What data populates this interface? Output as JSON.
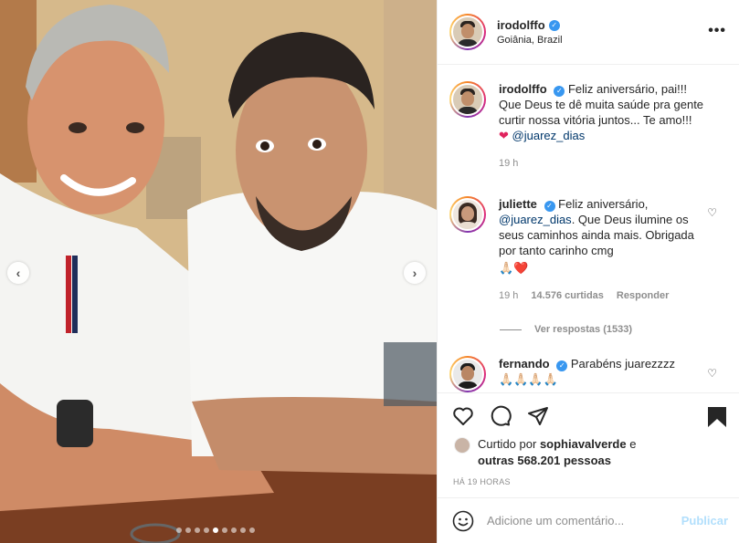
{
  "photo": {
    "dots_total": 9,
    "dots_active": 5
  },
  "header": {
    "username": "irodolffo",
    "location": "Goiânia, Brazil",
    "more_label": "•••"
  },
  "caption": {
    "username": "irodolffo",
    "text": "Feliz aniversário, pai!!! Que Deus te dê muita saúde pra gente curtir nossa vitória juntos... Te amo!!!",
    "mention": "@juarez_dias",
    "time": "19 h"
  },
  "comments": [
    {
      "username": "juliette",
      "text_before": "Feliz aniversário,",
      "mention": "@juarez_dias",
      "text_after": ". Que Deus ilumine os seus caminhos ainda mais. Obrigada por tanto carinho cmg",
      "emoji": "🙏🏻❤️",
      "time": "19 h",
      "likes": "14.576 curtidas",
      "reply": "Responder",
      "view_replies": "Ver respostas (1533)"
    },
    {
      "username": "fernando",
      "text": "Parabéns juarezzzz",
      "emoji": "🙏🏻🙏🏻🙏🏻🙏🏻"
    }
  ],
  "likes": {
    "prefix": "Curtido por",
    "user": "sophiavalverde",
    "mid": "e",
    "others": "outras 568.201 pessoas"
  },
  "timestamp": "HÁ 19 HORAS",
  "composer": {
    "placeholder": "Adicione um comentário...",
    "publish": "Publicar"
  }
}
